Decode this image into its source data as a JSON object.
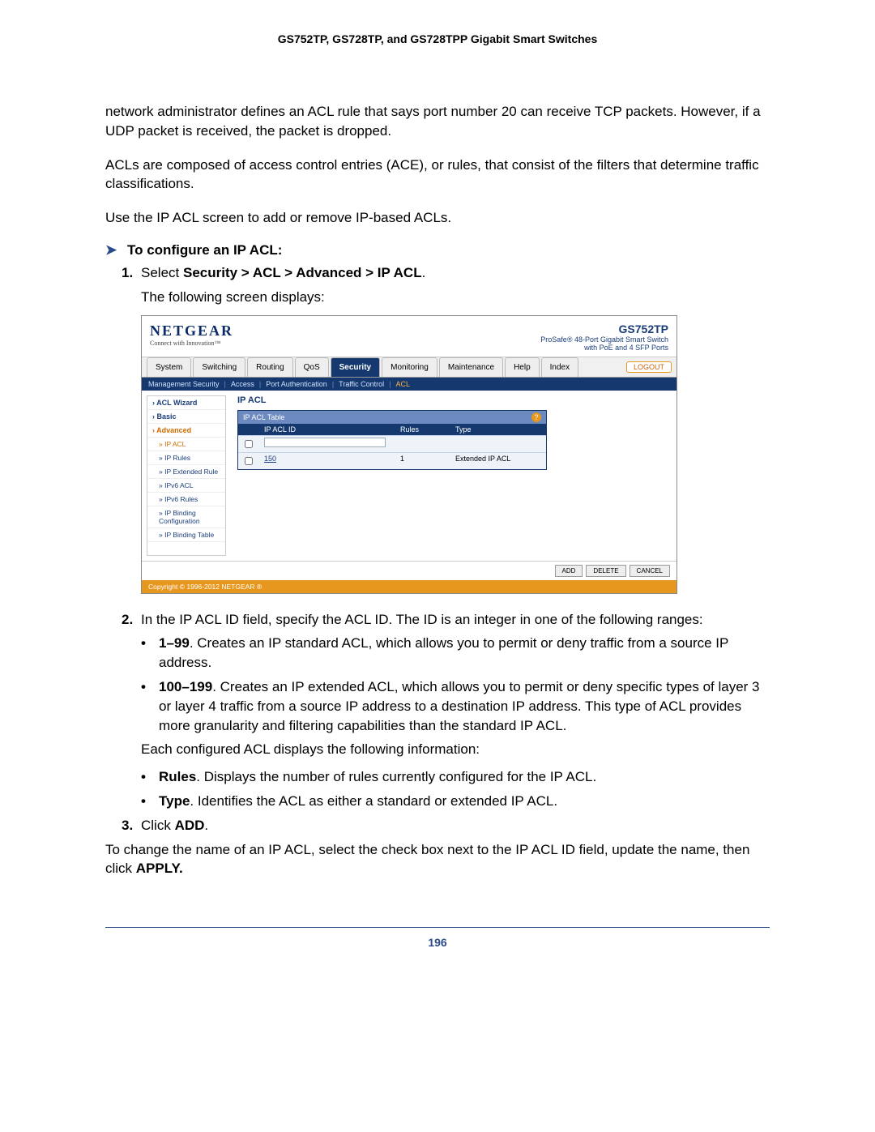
{
  "header_title": "GS752TP, GS728TP, and GS728TPP Gigabit Smart Switches",
  "para1": "network administrator defines an ACL rule that says port number 20 can receive TCP packets. However, if a UDP packet is received, the packet is dropped.",
  "para2": "ACLs are composed of access control entries (ACE), or rules, that consist of the filters that determine traffic classifications.",
  "para3": "Use the IP ACL screen to add or remove IP-based ACLs.",
  "step_heading": "To configure an IP ACL:",
  "step1_prefix": "Select ",
  "step1_bold": "Security > ACL > Advanced > IP ACL",
  "step1_suffix": ".",
  "step1_follow": "The following screen displays:",
  "step2": "In the IP ACL ID field, specify the ACL ID. The ID is an integer in one of the following ranges:",
  "step2b1_b": "1–99",
  "step2b1_t": ". Creates an IP standard ACL, which allows you to permit or deny traffic from a source IP address.",
  "step2b2_b": "100–199",
  "step2b2_t": ". Creates an IP extended ACL, which allows you to permit or deny specific types of layer 3 or layer 4 traffic from a source IP address to a destination IP address. This type of ACL provides more granularity and filtering capabilities than the standard IP ACL.",
  "step2_each": "Each configured ACL displays the following information:",
  "step2_rules_b": "Rules",
  "step2_rules_t": ". Displays the number of rules currently configured for the IP ACL.",
  "step2_type_b": "Type",
  "step2_type_t": ". Identifies the ACL as either a standard or extended IP ACL.",
  "step3_pre": "Click ",
  "step3_b": "ADD",
  "step3_post": ".",
  "final1": "To change the name of an IP ACL, select the check box next to the IP ACL ID field, update the name, then click ",
  "final1_b": "APPLY.",
  "page_number": "196",
  "screenshot": {
    "brand": "NETGEAR",
    "brand_tag": "Connect with Innovation™",
    "model": "GS752TP",
    "model_sub1": "ProSafe® 48-Port Gigabit Smart Switch",
    "model_sub2": "with PoE and 4 SFP Ports",
    "tabs": [
      "System",
      "Switching",
      "Routing",
      "QoS",
      "Security",
      "Monitoring",
      "Maintenance",
      "Help",
      "Index"
    ],
    "active_tab": "Security",
    "logout": "LOGOUT",
    "subnav": [
      "Management Security",
      "Access",
      "Port Authentication",
      "Traffic Control",
      "ACL"
    ],
    "subnav_active": "ACL",
    "leftnav_top": [
      "ACL Wizard",
      "Basic",
      "Advanced"
    ],
    "leftnav_active": "Advanced",
    "leftnav_sub": [
      "IP ACL",
      "IP Rules",
      "IP Extended Rule",
      "IPv6 ACL",
      "IPv6 Rules",
      "IP Binding Configuration",
      "IP Binding Table"
    ],
    "leftnav_sub_active": "IP ACL",
    "panel_title": "IP ACL",
    "table_title": "IP ACL Table",
    "cols": {
      "id": "IP ACL ID",
      "rules": "Rules",
      "type": "Type"
    },
    "row": {
      "id": "150",
      "rules": "1",
      "type": "Extended IP ACL"
    },
    "buttons": [
      "ADD",
      "DELETE",
      "CANCEL"
    ],
    "copyright": "Copyright © 1996-2012 NETGEAR ®"
  }
}
